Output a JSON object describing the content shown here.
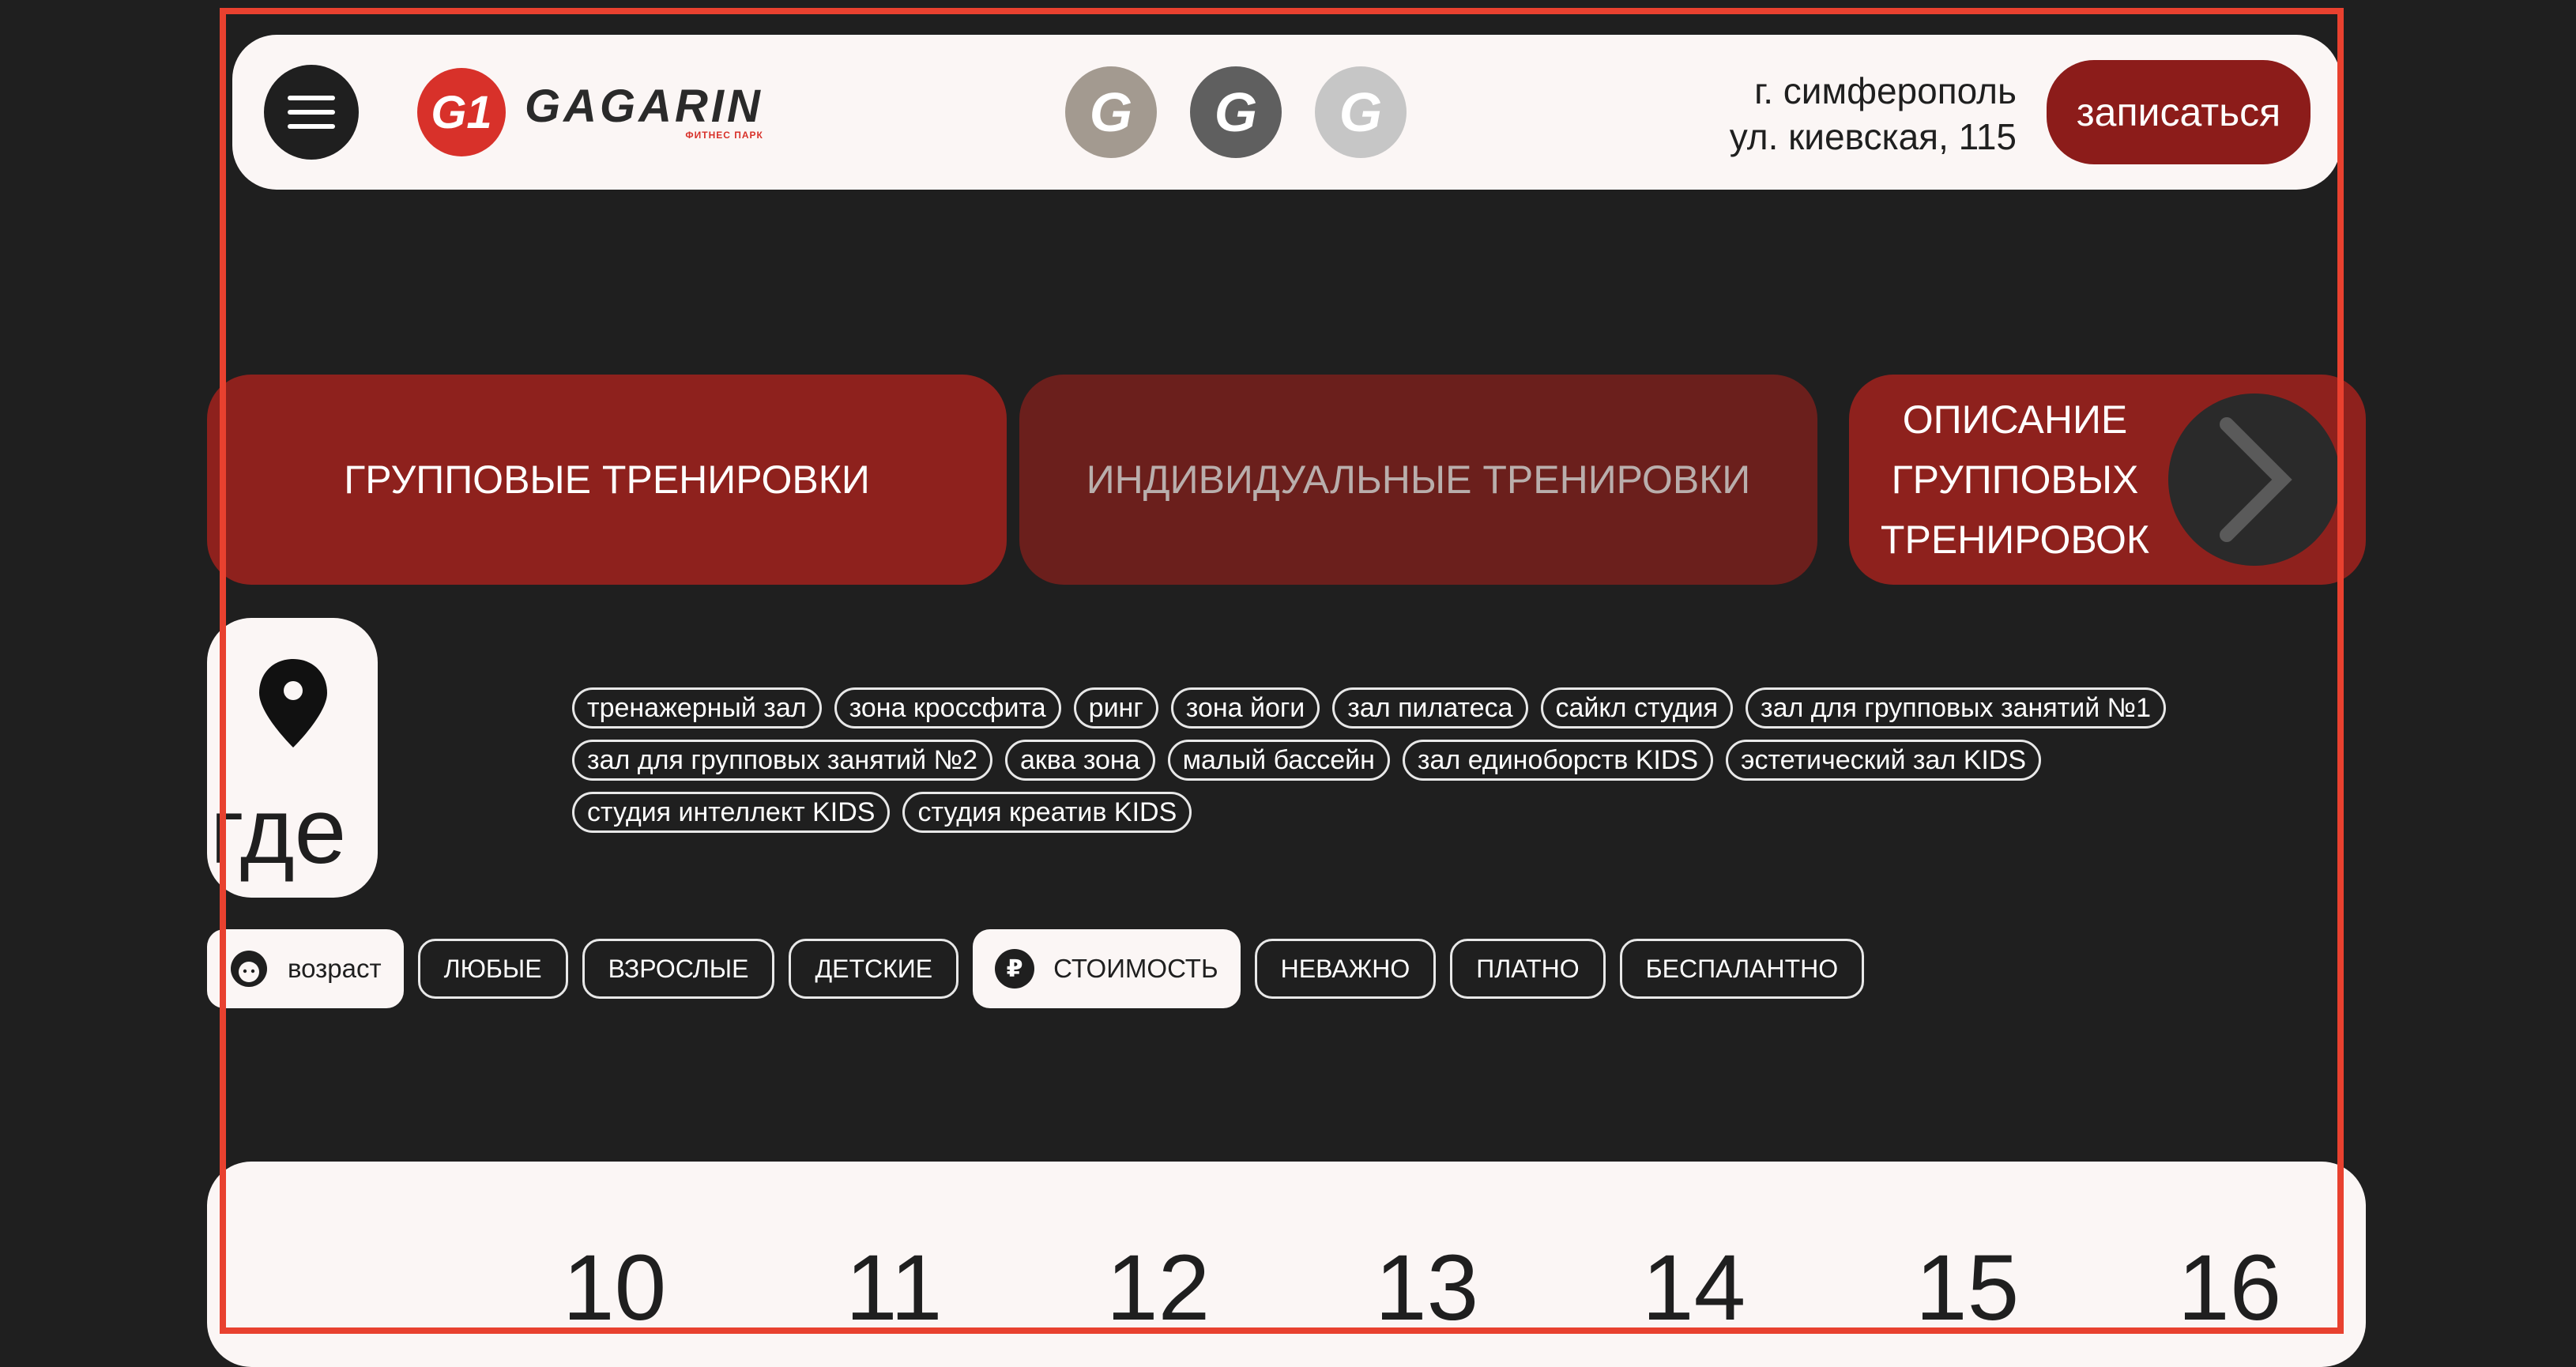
{
  "header": {
    "logo_mark": "G1",
    "logo_text": "GAGARIN",
    "logo_sub": "ФИТНЕС ПАРК",
    "brand_icons": [
      "G",
      "G",
      "G"
    ],
    "address_line1": "г. симферополь",
    "address_line2": "ул. киевская, 115",
    "signup_label": "записаться"
  },
  "tabs": {
    "group": "ГРУППОВЫЕ ТРЕНИРОВКИ",
    "individual": "ИНДИВИДУАЛЬНЫЕ ТРЕНИРОВКИ",
    "description_lines": [
      "ОПИСАНИЕ",
      "ГРУППОВЫХ",
      "ТРЕНИРОВОК"
    ]
  },
  "where": {
    "label": "где",
    "zones": [
      "тренажерный зал",
      "зона кроссфита",
      "ринг",
      "зона йоги",
      "зал пилатеса",
      "сайкл студия",
      "зал для групповых занятий №1",
      "зал для групповых занятий №2",
      "аква зона",
      "малый бассейн",
      "зал единоборств KIDS",
      "эстетический зал KIDS",
      "студия интеллект KIDS",
      "студия креатив KIDS"
    ]
  },
  "filters": {
    "age_label": "возраст",
    "age_options": [
      "ЛЮБЫЕ",
      "ВЗРОСЛЫЕ",
      "ДЕТСКИЕ"
    ],
    "cost_label": "СТОИМОСТЬ",
    "cost_icon": "₽",
    "cost_options": [
      "НЕВАЖНО",
      "ПЛАТНО",
      "БЕСПАЛАНТНО"
    ]
  },
  "calendar": {
    "days": [
      "10",
      "11",
      "12",
      "13",
      "14",
      "15",
      "16"
    ]
  },
  "colors": {
    "accent": "#8e211d",
    "frame": "#e8412f",
    "background": "#1f1f1f"
  }
}
